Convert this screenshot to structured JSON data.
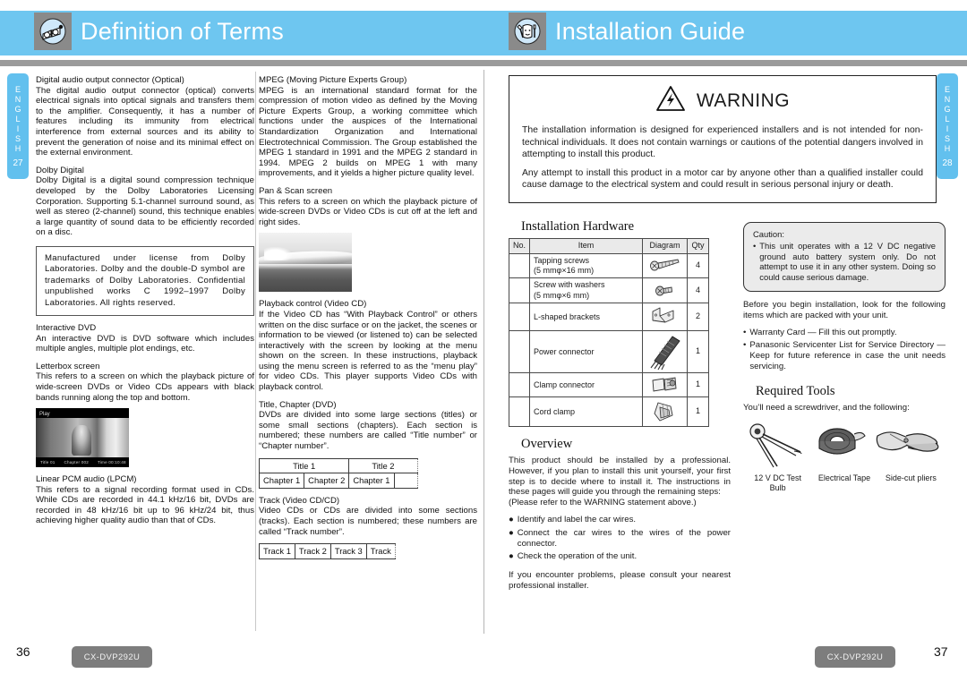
{
  "header": {
    "left_title": "Definition of Terms",
    "right_title": "Installation Guide",
    "left_icon": "book-glasses-icon",
    "right_icon": "installer-tools-icon",
    "band_color": "#6ec6f0",
    "rule_color": "#9b9b9b"
  },
  "side_tabs": {
    "left": {
      "letters": "ENGLISH",
      "page": "27"
    },
    "right": {
      "letters": "ENGLISH",
      "page": "28"
    }
  },
  "col1": {
    "terms": [
      {
        "title": "Digital audio output connector (Optical)",
        "body": "The digital audio output connector (optical) converts electrical signals into optical signals and transfers them to the amplifier. Consequently, it has a number of features including its immunity from electrical interference from external sources and its ability to prevent the generation of noise and its minimal effect on the external environment."
      },
      {
        "title": "Dolby Digital",
        "body": "Dolby Digital is a digital sound compression technique developed by the Dolby Laboratories Licensing Corporation.\nSupporting 5.1-channel surround sound, as well as stereo (2-channel) sound, this technique enables a large quantity of sound data to be efficiently recorded on a disc."
      }
    ],
    "license_box": "Manufactured under license from Dolby Laboratories. Dolby and the double-D symbol are trademarks of Dolby Laboratories. Confidential unpublished works C 1992–1997 Dolby Laboratories. All rights reserved.",
    "terms2": [
      {
        "title": "Interactive DVD",
        "body": "An interactive DVD is DVD software which includes multiple angles, multiple plot endings, etc."
      },
      {
        "title": "Letterbox screen",
        "body": "This refers to a screen on which the playback picture of wide-screen DVDs or Video CDs appears with black bands running along the top and bottom."
      }
    ],
    "letterbox_image": {
      "name": "letterbox-screen-photo",
      "overlay_label": "Play",
      "footer_items": [
        "Title 01",
        "Chapter 002",
        "Time 00:10:48"
      ]
    },
    "terms3": [
      {
        "title": "Linear PCM audio (LPCM)",
        "body": "This refers to a signal recording format used in CDs. While CDs are recorded in 44.1 kHz/16 bit, DVDs are recorded in 48 kHz/16 bit up to 96 kHz/24 bit, thus achieving higher quality audio than that of CDs."
      }
    ]
  },
  "col2": {
    "terms": [
      {
        "title": "MPEG (Moving Picture Experts Group)",
        "body": "MPEG is an international standard format for the compression of motion video as defined by the Moving Picture Experts Group, a working committee which functions under the auspices of the International Standardization Organization and International Electrotechnical Commission. The Group established the MPEG 1 standard in 1991 and the MPEG 2 standard in 1994. MPEG 2 builds on MPEG 1 with many improvements, and it yields a higher picture quality level."
      },
      {
        "title": "Pan & Scan screen",
        "body": "This refers to a screen on which the playback picture of wide-screen DVDs or Video CDs is cut off at the left and right sides."
      }
    ],
    "panscan_image": {
      "name": "pan-and-scan-photo"
    },
    "terms2": [
      {
        "title": "Playback control (Video CD)",
        "body": "If the Video CD has “With Playback Control” or others written on the disc surface or on the jacket, the scenes or information to be viewed (or listened to) can be selected interactively with the screen by looking at the menu shown on the screen.\nIn these instructions, playback using the menu screen is referred to as the “menu play” for video CDs. This player supports Video CDs with playback control."
      },
      {
        "title": "Title, Chapter (DVD)",
        "body": "DVDs are divided into some large sections (titles) or some small sections (chapters). Each section is numbered; these numbers are called “Title number” or “Chapter number”."
      }
    ],
    "title_chapter_table": {
      "row1": [
        "Title 1",
        "Title 2"
      ],
      "row2": [
        "Chapter 1",
        "Chapter 2",
        "Chapter 1",
        ""
      ]
    },
    "terms3": [
      {
        "title": "Track (Video CD/CD)",
        "body": "Video CDs or CDs are divided into some sections (tracks). Each section is numbered; these numbers are called “Track number”."
      }
    ],
    "track_table": [
      "Track 1",
      "Track 2",
      "Track 3",
      "Track"
    ]
  },
  "warning": {
    "icon": "electric-shock-triangle-icon",
    "title": "WARNING",
    "paragraphs": [
      "The installation information is designed for experienced installers and is not intended for non-technical individuals. It does not contain warnings or cautions of the potential dangers involved in attempting to install this product.",
      "Any attempt to install this product in a motor car by anyone other than a qualified installer could cause damage to the electrical system and could result in serious personal injury or death."
    ]
  },
  "installation_hardware": {
    "title": "Installation Hardware",
    "headers": [
      "No.",
      "Item",
      "Diagram",
      "Qty"
    ],
    "rows": [
      {
        "no": "",
        "item": "Tapping screws\n(5 mmφ×16 mm)",
        "diagram": "tapping-screw-icon",
        "qty": "4"
      },
      {
        "no": "",
        "item": "Screw with washers\n(5 mmφ×6 mm)",
        "diagram": "screw-with-washer-icon",
        "qty": "4"
      },
      {
        "no": "",
        "item": "L-shaped brackets",
        "diagram": "l-bracket-icon",
        "qty": "2"
      },
      {
        "no": "",
        "item": "Power connector",
        "diagram": "power-connector-icon",
        "qty": "1"
      },
      {
        "no": "",
        "item": "Clamp connector",
        "diagram": "clamp-connector-icon",
        "qty": "1"
      },
      {
        "no": "",
        "item": "Cord clamp",
        "diagram": "cord-clamp-icon",
        "qty": "1"
      }
    ]
  },
  "overview": {
    "title": "Overview",
    "paragraph": "This product should be installed by a professional. However, if you plan to install this unit yourself, your first step is to decide where to install it. The instructions in these pages will guide you through the remaining steps:\n(Please refer to the WARNING statement above.)",
    "bullets": [
      "Identify and label the car wires.",
      "Connect the car wires to the wires of the power connector.",
      "Check the operation of the unit."
    ],
    "closing": "If you encounter problems, please consult your nearest professional installer."
  },
  "caution": {
    "label": "Caution:",
    "text": "This unit operates with a 12 V DC negative ground auto battery system only. Do not attempt to use it in any other system. Doing so could cause serious damage."
  },
  "packed_items": {
    "intro": "Before you begin installation, look for the following items which are packed with your unit.",
    "bullets": [
      "Warranty Card — Fill this out promptly.",
      "Panasonic Servicenter List for Service Directory — Keep for future reference in case the unit needs servicing."
    ]
  },
  "required_tools": {
    "title": "Required Tools",
    "intro": "You’ll need a screwdriver, and the following:",
    "tools": [
      {
        "icon": "test-bulb-icon",
        "label": "12 V DC Test\nBulb"
      },
      {
        "icon": "electrical-tape-icon",
        "label": "Electrical Tape"
      },
      {
        "icon": "side-cut-pliers-icon",
        "label": "Side-cut pliers"
      }
    ]
  },
  "footer": {
    "left_page": "36",
    "right_page": "37",
    "left_model": "CX-DVP292U",
    "right_model": "CX-DVP292U"
  }
}
